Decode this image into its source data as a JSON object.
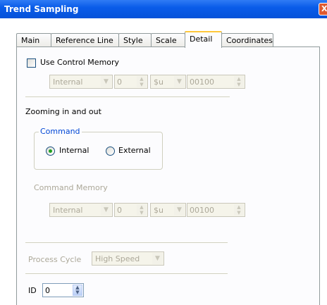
{
  "window": {
    "title": "Trend Sampling",
    "close_glyph": "X"
  },
  "tabs": [
    {
      "label": "Main"
    },
    {
      "label": "Reference Line"
    },
    {
      "label": "Style"
    },
    {
      "label": "Scale"
    },
    {
      "label": "Detail"
    },
    {
      "label": "Coordinates"
    }
  ],
  "active_tab": "Detail",
  "control_memory": {
    "label": "Use Control Memory",
    "checked": false,
    "device": "Internal",
    "station": "0",
    "type": "$u",
    "address": "00100"
  },
  "zooming": {
    "heading": "Zooming in and out",
    "group_label": "Command",
    "options": [
      {
        "label": "Internal",
        "selected": true
      },
      {
        "label": "External",
        "selected": false
      }
    ]
  },
  "command_memory": {
    "label": "Command Memory",
    "device": "Internal",
    "station": "0",
    "type": "$u",
    "address": "00100"
  },
  "process_cycle": {
    "label": "Process Cycle",
    "value": "High Speed"
  },
  "id_field": {
    "label": "ID",
    "value": "0"
  },
  "colors": {
    "titlebar": "#0a5ce9",
    "accent": "#0046d5",
    "disabled_text": "#aca899"
  }
}
